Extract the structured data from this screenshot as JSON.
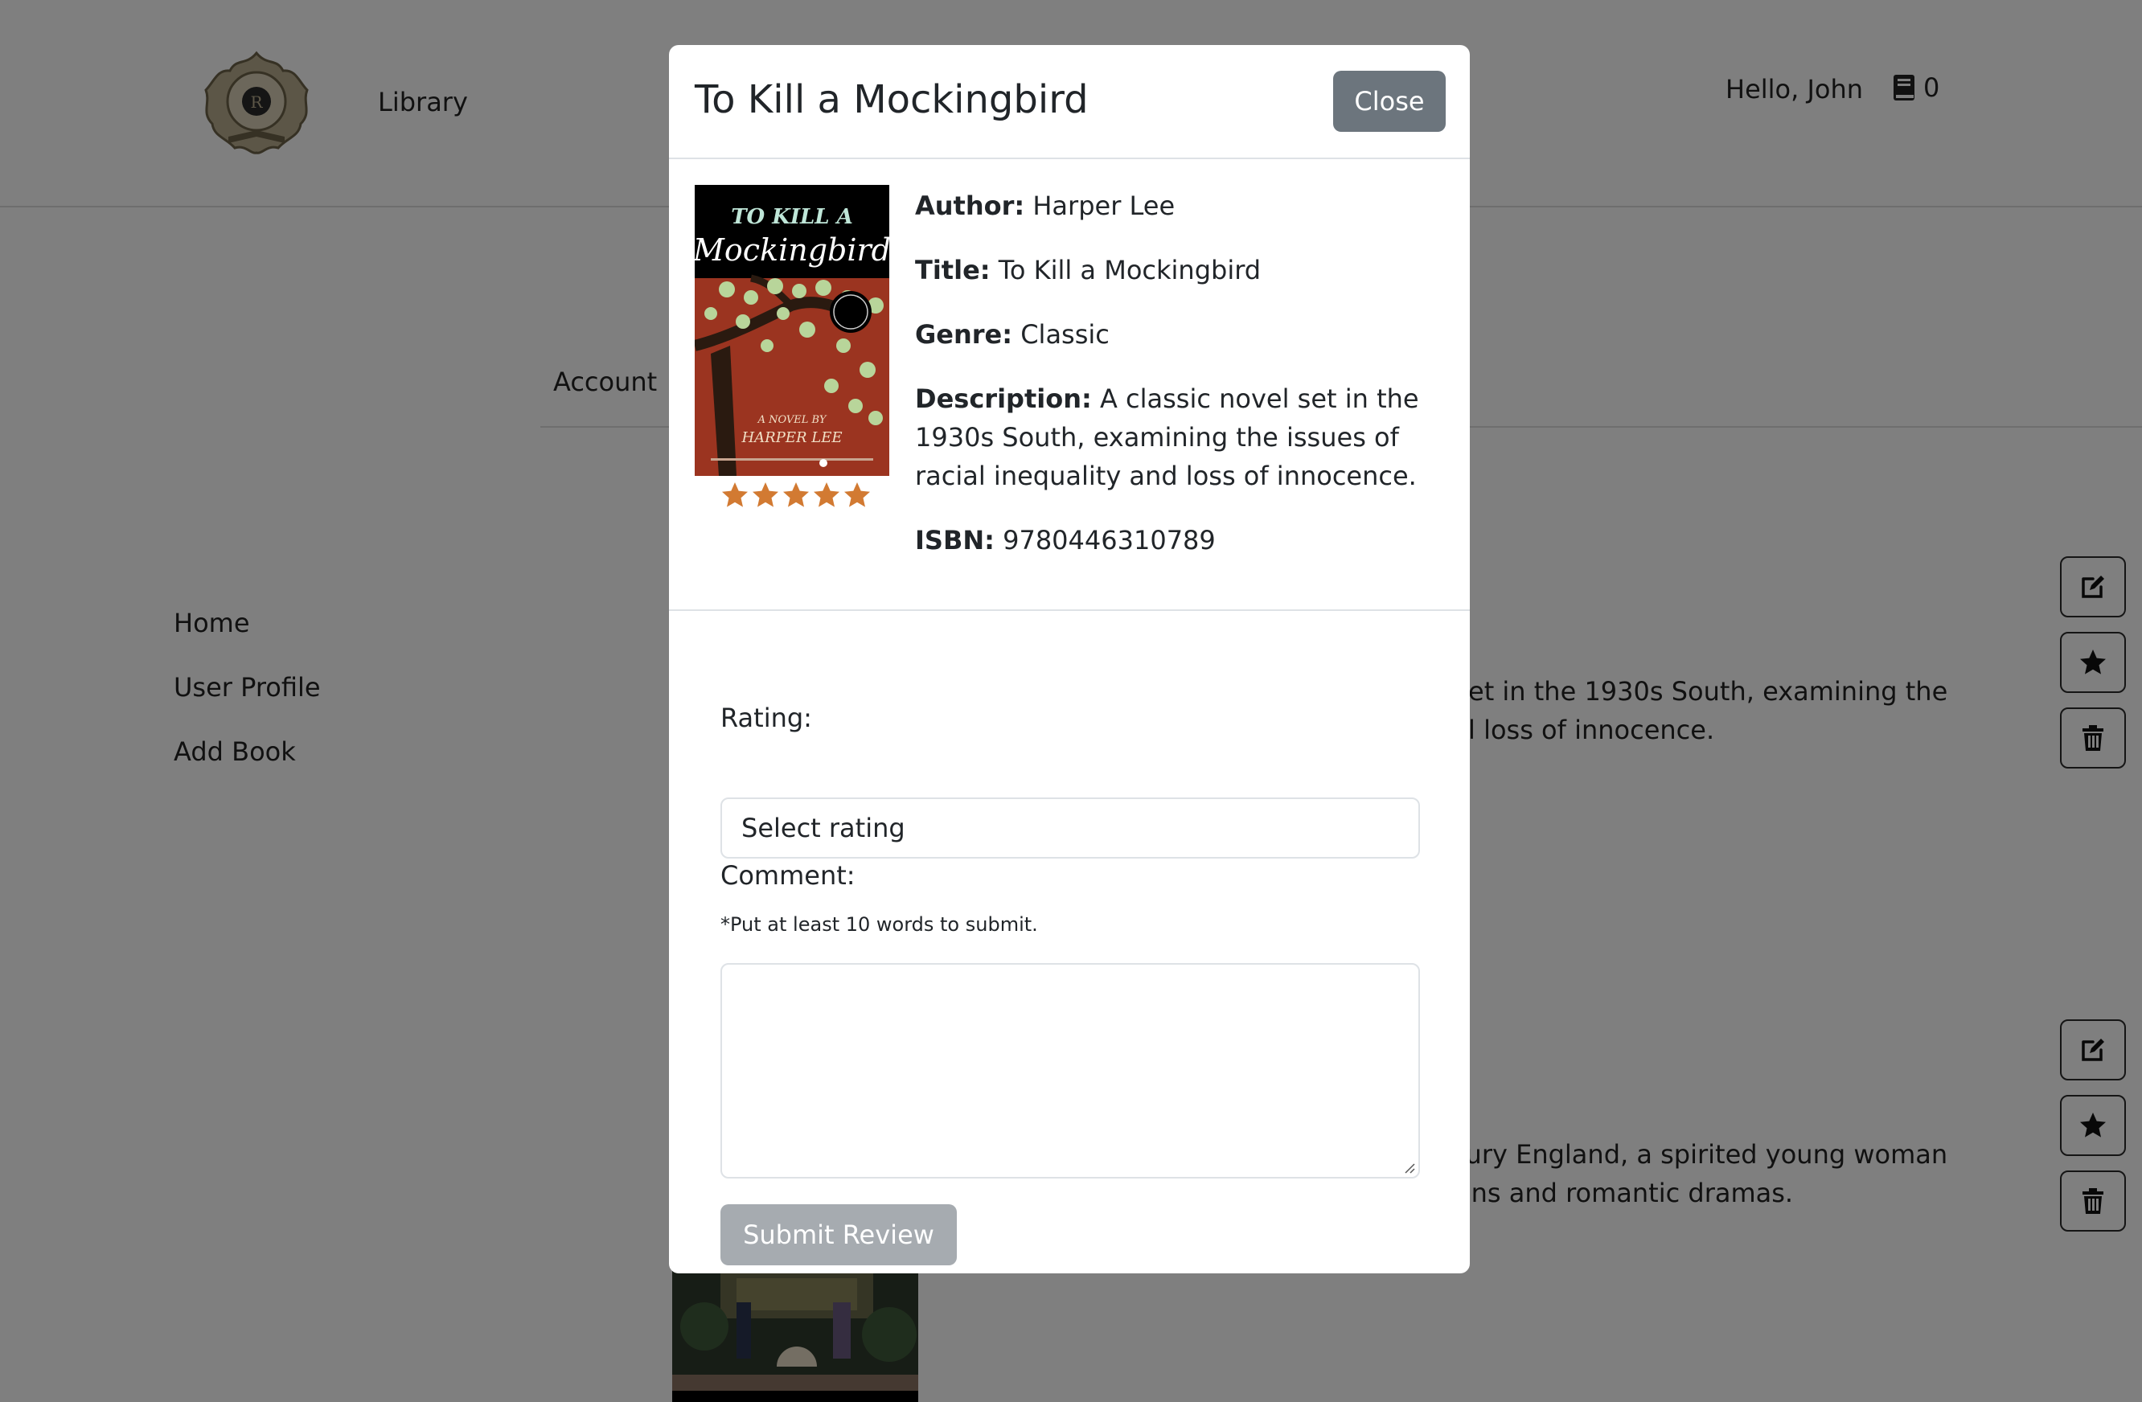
{
  "navbar": {
    "library_label": "Library",
    "greeting": "Hello, John",
    "cart_count": "0"
  },
  "account_tab_label": "Account",
  "sidebar": {
    "items": [
      {
        "label": "Home"
      },
      {
        "label": "User Profile"
      },
      {
        "label": "Add Book"
      }
    ]
  },
  "background_books": [
    {
      "description_line1": "et in the 1930s South, examining the",
      "description_line2": "l loss of innocence."
    },
    {
      "description_line1": "tury England, a spirited young woman",
      "description_line2": "ons and romantic dramas."
    }
  ],
  "modal": {
    "title": "To Kill a Mockingbird",
    "close_label": "Close",
    "cover": {
      "line1": "TO KILL A",
      "line2": "Mockingbird",
      "line3": "A NOVEL BY",
      "line4": "HARPER LEE"
    },
    "rating_stars": 5,
    "details": {
      "author_label": "Author:",
      "author": "Harper Lee",
      "title_label": "Title:",
      "title": "To Kill a Mockingbird",
      "genre_label": "Genre:",
      "genre": "Classic",
      "description_label": "Description:",
      "description": "A classic novel set in the 1930s South, examining the issues of racial inequality and loss of innocence.",
      "isbn_label": "ISBN:",
      "isbn": "9780446310789"
    },
    "form": {
      "rating_label": "Rating:",
      "rating_selected": "Select rating",
      "comment_label": "Comment:",
      "hint": "*Put at least 10 words to submit.",
      "comment_value": "",
      "submit_label": "Submit Review"
    }
  },
  "colors": {
    "backdrop": "rgba(0,0,0,0.5)",
    "close_button": "#6c757d",
    "submit_button_disabled": "#a6abb0",
    "star": "#d27a32",
    "cover_red": "#9b3420"
  }
}
